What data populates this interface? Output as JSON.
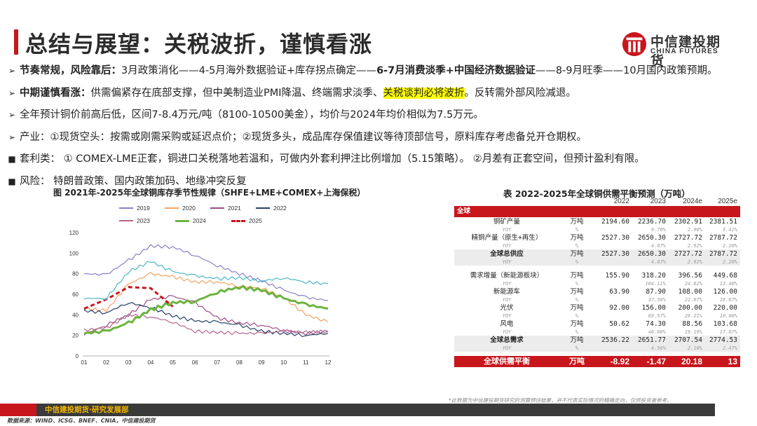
{
  "header": {
    "title": "总结与展望：关税波折，谨慎看涨",
    "logo_cn": "中信建投期货",
    "logo_en": "CHINA FUTURES"
  },
  "bullets": [
    {
      "mark": "➢",
      "bold": "节奏常规，风险靠后：",
      "text": "3月政策消化——4-5月海外数据验证+库存拐点确定——",
      "bold2": "6-7月消费淡季+中国经济数据验证",
      "text2": "——8-9月旺季——10月国内政策预期。"
    },
    {
      "mark": "➢",
      "bold": "中期谨慎看涨：",
      "text": "供需偏紧存在底部支撑，但中美制造业PMI降温、终端需求淡季、",
      "highlight": "关税谈判必将波折",
      "text2": "。反转需外部风险减退。"
    },
    {
      "mark": "➢",
      "text": "全年预计铜价前高后低，区间7-8.4万元/吨（8100-10500美金），均价与2024年均价相似为7.5万元。"
    },
    {
      "mark": "➢",
      "text": "产业：①现货空头：按需或刚需采购或延迟点价；②现货多头，成品库存保值建议等待顶部信号，原料库存考虑备兑开仓期权。"
    },
    {
      "mark": "■",
      "text": "套利类： ① COMEX-LME正套，铜进口关税落地若温和，可做内外套利押注比例增加（5.15策略）。 ②月差有正套空间，但预计盈利有限。"
    },
    {
      "mark": "■",
      "text": "风险：  特朗普政策、国内政策加码、地缘冲突反复"
    }
  ],
  "chart": {
    "title": "图 2021年-2025年全球铜库存季节性规律（SHFE+LME+COMEX+上海保税）"
  },
  "chart_data": {
    "type": "line",
    "x": [
      "01",
      "02",
      "03",
      "04",
      "05",
      "06",
      "07",
      "08",
      "09",
      "10",
      "11",
      "12"
    ],
    "ylim": [
      0,
      120
    ],
    "yticks": [
      0,
      20,
      40,
      60,
      80,
      100,
      120
    ],
    "series": [
      {
        "name": "2019",
        "color": "#8b7fc7",
        "values": [
          80,
          79,
          93,
          107,
          106,
          98,
          88,
          80,
          73,
          64,
          57,
          54
        ]
      },
      {
        "name": "2020",
        "color": "#f4a261",
        "values": [
          46,
          44,
          70,
          80,
          77,
          72,
          72,
          68,
          66,
          57,
          40,
          33
        ]
      },
      {
        "name": "2021",
        "color": "#9e4a86",
        "values": [
          21,
          30,
          40,
          55,
          58,
          52,
          37,
          32,
          30,
          25,
          22,
          24
        ]
      },
      {
        "name": "2022",
        "color": "#25406a",
        "values": [
          44,
          42,
          52,
          47,
          39,
          34,
          33,
          30,
          24,
          22,
          20,
          22
        ]
      },
      {
        "name": "2023",
        "color": "#b5648a",
        "values": [
          25,
          27,
          40,
          38,
          33,
          24,
          23,
          22,
          22,
          24,
          23,
          24
        ]
      },
      {
        "name": "2024",
        "color": "#6bb43f",
        "values": [
          22,
          24,
          32,
          45,
          52,
          53,
          62,
          67,
          64,
          56,
          50,
          46
        ]
      },
      {
        "name": "2025",
        "color": "#c8161d",
        "dashed": true,
        "values": [
          46,
          55,
          67,
          66,
          48
        ]
      },
      {
        "name": "",
        "color": "#4bb8c9",
        "values": [
          56,
          56,
          82,
          92,
          82,
          78,
          75,
          76,
          73,
          76,
          72,
          70
        ]
      }
    ]
  },
  "table": {
    "title": "表 2022-2025年全球铜供需平衡预测（万吨）",
    "years": [
      "2022",
      "2023",
      "2024e",
      "2025e"
    ],
    "section": "全球",
    "rows": [
      {
        "name": "铜矿产量",
        "unit": "万吨",
        "v": [
          "2194.60",
          "2236.70",
          "2302.91",
          "2381.51"
        ],
        "yoy": [
          "",
          "9.70%",
          "2.96%",
          "3.41%"
        ]
      },
      {
        "name": "精铜产量（原生+再生）",
        "unit": "万吨",
        "v": [
          "2527.30",
          "2650.30",
          "2727.72",
          "2787.72"
        ],
        "yoy": [
          "",
          "4.87%",
          "2.92%",
          "2.20%"
        ]
      },
      {
        "name": "全球总供应",
        "unit": "万吨",
        "bold": true,
        "v": [
          "2527.30",
          "2650.30",
          "2727.72",
          "2787.72"
        ],
        "yoy": [
          "",
          "4.87%",
          "2.92%",
          "2.20%"
        ]
      },
      {
        "name": "需求增量（新能源板块）",
        "unit": "万吨",
        "v": [
          "155.90",
          "318.20",
          "396.56",
          "449.68"
        ],
        "yoy": [
          "",
          "104.11%",
          "24.62%",
          "13.40%"
        ]
      },
      {
        "name": "新能源车",
        "unit": "万吨",
        "v": [
          "63.90",
          "87.90",
          "108.00",
          "126.00"
        ],
        "yoy": [
          "",
          "37.56%",
          "22.87%",
          "16.67%"
        ]
      },
      {
        "name": "光伏",
        "unit": "万吨",
        "v": [
          "92.00",
          "156.00",
          "200.00",
          "220.00"
        ],
        "yoy": [
          "",
          "69.57%",
          "28.21%",
          "10.00%"
        ]
      },
      {
        "name": "风电",
        "unit": "万吨",
        "v": [
          "50.62",
          "74.30",
          "88.56",
          "103.68"
        ],
        "yoy": [
          "",
          "46.80%",
          "19.19%",
          "17.07%"
        ]
      },
      {
        "name": "全球总需求",
        "unit": "万吨",
        "bold": true,
        "v": [
          "2536.22",
          "2651.77",
          "2707.54",
          "2774.53"
        ],
        "yoy": [
          "",
          "4.56%",
          "2.10%",
          "2.47%"
        ]
      }
    ],
    "yoy_label": "YOY",
    "yoy_unit": "%",
    "balance": {
      "name": "全球供需平衡",
      "unit": "万吨",
      "v": [
        "-8.92",
        "-1.47",
        "20.18",
        "13"
      ]
    }
  },
  "footer": {
    "text": "中信建投期货·研究发展部",
    "note": "*此数据为中信建投期货研究的测算预估结果，并不代表实际情况的精确走向，仅供投资者参考。",
    "source": "数据来源：WIND、ICSG、BNEF、CNIA，中信建投期货"
  }
}
